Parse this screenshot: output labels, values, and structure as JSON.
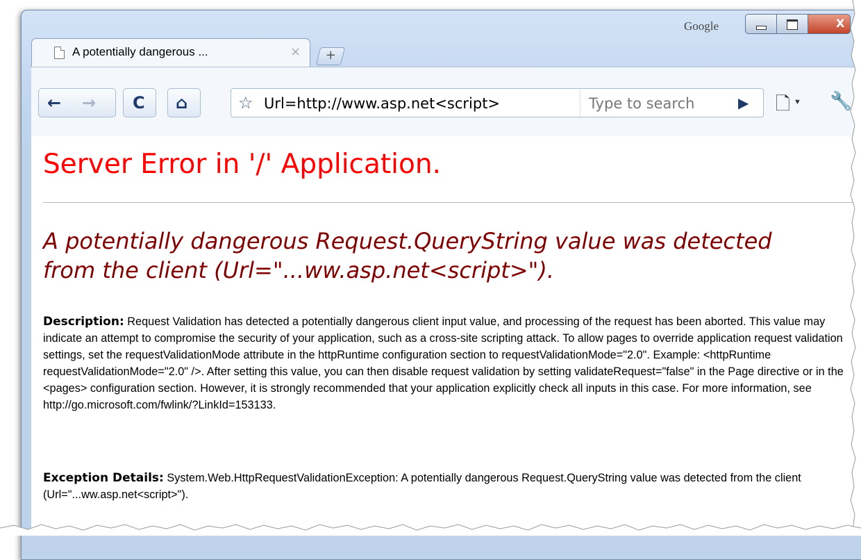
{
  "browser": {
    "brand_label": "Google",
    "tab": {
      "title": "A potentially dangerous ...",
      "close_glyph": "×"
    },
    "new_tab_glyph": "+",
    "window_buttons": {
      "minimize_icon": "minimize-icon",
      "maximize_icon": "maximize-icon",
      "close_glyph": "X"
    },
    "toolbar": {
      "back_glyph": "←",
      "forward_glyph": "→",
      "reload_glyph": "C",
      "home_glyph": "⌂",
      "bookmark_glyph": "☆",
      "address_value": "Url=http://www.asp.net<script>",
      "search_placeholder": "Type to search",
      "go_glyph": "▶",
      "page_menu_glyph": "🗋",
      "wrench_glyph": "🔧"
    }
  },
  "page": {
    "title": "Server Error in '/' Application.",
    "error_heading": "A potentially dangerous Request.QueryString value was detected from the client (Url=\"...ww.asp.net<script>\").",
    "description": {
      "label": "Description:",
      "text": " Request Validation has detected a potentially dangerous client input value, and processing of the request has been aborted. This value may indicate an attempt to compromise the security of your application, such as a cross-site scripting attack. To allow pages to override application request validation settings, set the requestValidationMode attribute in the httpRuntime configuration section to requestValidationMode=\"2.0\". Example: <httpRuntime requestValidationMode=\"2.0\" />. After setting this value, you can then disable request validation by setting validateRequest=\"false\" in the Page directive or in the <pages> configuration section. However, it is strongly recommended that your application explicitly check all inputs in this case. For more information, see http://go.microsoft.com/fwlink/?LinkId=153133."
    },
    "exception": {
      "label": "Exception Details:",
      "text": " System.Web.HttpRequestValidationException: A potentially dangerous Request.QueryString value was detected from the client (Url=\"...ww.asp.net<script>\")."
    }
  },
  "colors": {
    "title_red": "#ff0000",
    "heading_maroon": "#800000",
    "chrome_blue": "#c3d6ef",
    "nav_blue": "#1d3a6a"
  }
}
